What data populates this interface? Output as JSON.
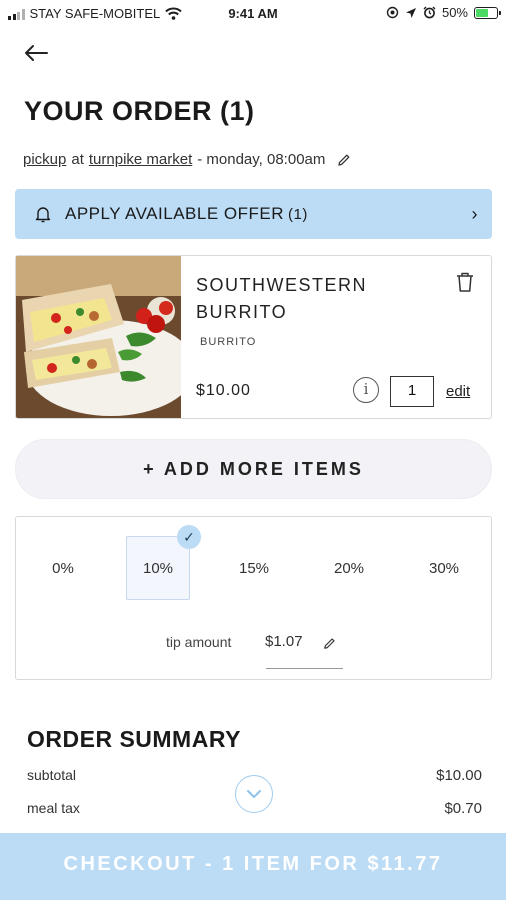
{
  "status_bar": {
    "carrier": "STAY SAFE-MOBITEL",
    "time": "9:41 AM",
    "battery_percent": "50%"
  },
  "header": {
    "title": "YOUR ORDER (1)"
  },
  "pickup": {
    "mode": "pickup",
    "connector": "at",
    "location": "turnpike market",
    "schedule": "- monday, 08:00am"
  },
  "offer": {
    "label": "APPLY AVAILABLE OFFER",
    "count": "(1)"
  },
  "cart": {
    "items": [
      {
        "name": "SOUTHWESTERN BURRITO",
        "category": "BURRITO",
        "price": "$10.00",
        "quantity": "1",
        "edit_label": "edit"
      }
    ]
  },
  "add_more_label": "+ ADD MORE ITEMS",
  "tip": {
    "options": [
      "0%",
      "10%",
      "15%",
      "20%",
      "30%"
    ],
    "selected": "10%",
    "amount_label": "tip amount",
    "amount": "$1.07"
  },
  "summary": {
    "title": "ORDER SUMMARY",
    "rows": [
      {
        "label": "subtotal",
        "value": "$10.00"
      },
      {
        "label": "meal tax",
        "value": "$0.70"
      }
    ]
  },
  "checkout_label": "CHECKOUT - 1 ITEM FOR $11.77",
  "colors": {
    "accent": "#bcdcf6",
    "card_border": "#d9d9d9",
    "pill_bg": "#f2f2f7"
  },
  "icons": {
    "back": "back-arrow-icon",
    "edit": "pencil-icon",
    "offer": "bell-icon",
    "delete": "trash-icon",
    "info": "info-icon",
    "selected": "check-icon",
    "scroll": "chevron-down-icon"
  }
}
